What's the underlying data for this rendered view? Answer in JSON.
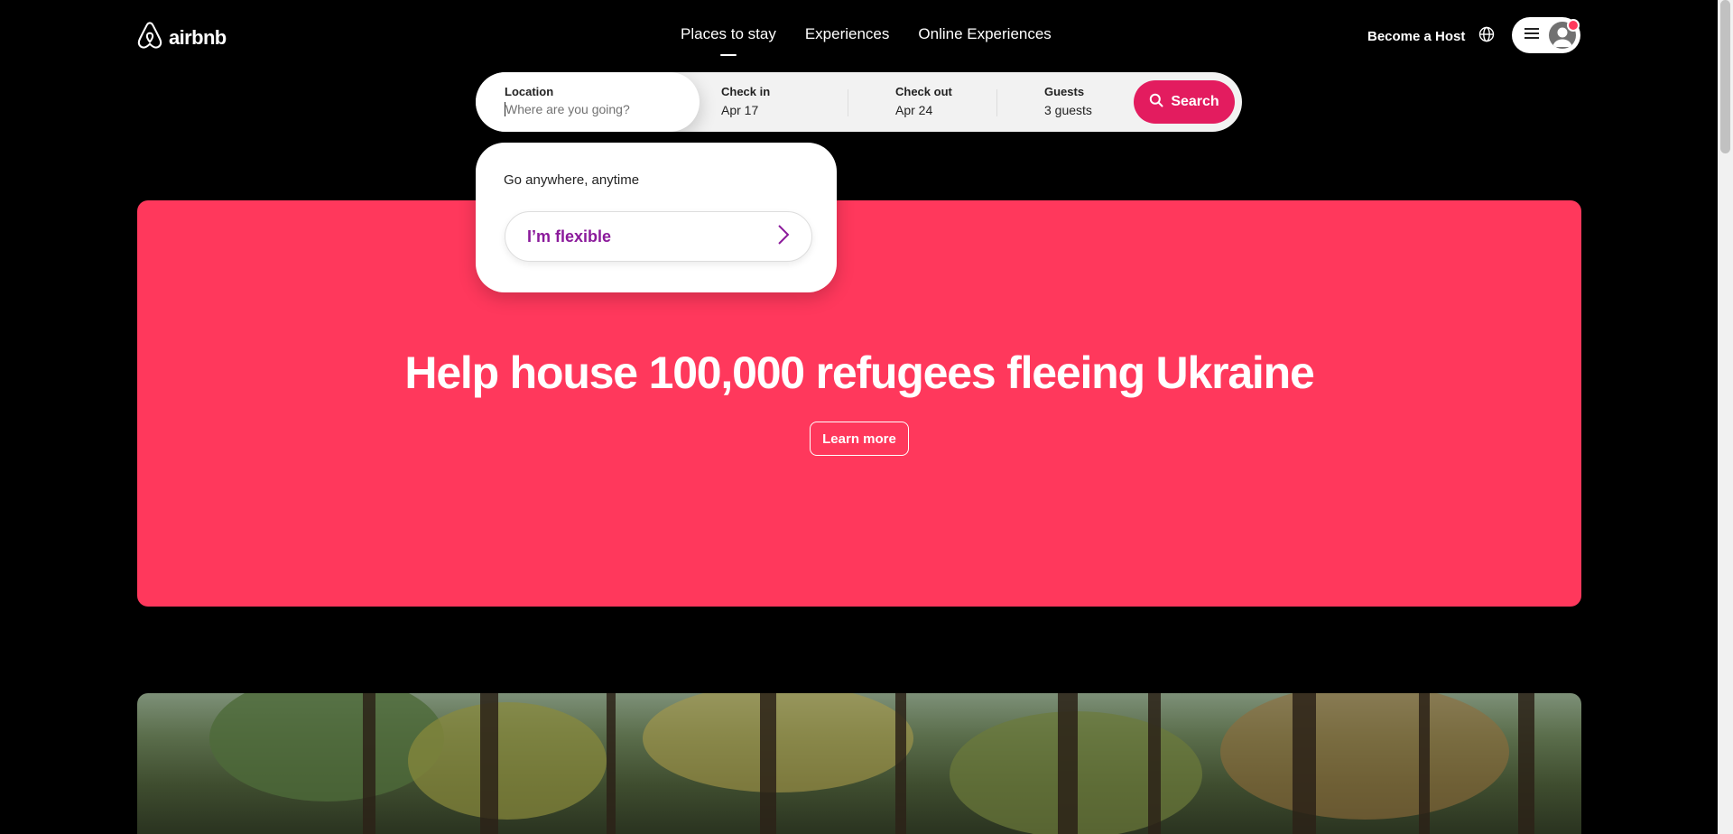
{
  "brand": {
    "name": "airbnb",
    "accent_color": "#FF385C"
  },
  "nav": {
    "tabs": [
      {
        "label": "Places to stay",
        "active": true
      },
      {
        "label": "Experiences",
        "active": false
      },
      {
        "label": "Online Experiences",
        "active": false
      }
    ],
    "host_link": "Become a Host",
    "globe_icon": "globe-icon",
    "menu_icon": "hamburger-menu-icon",
    "avatar_icon": "user-avatar-icon"
  },
  "search": {
    "location": {
      "label": "Location",
      "value": "",
      "placeholder": "Where are you going?"
    },
    "check_in": {
      "label": "Check in",
      "value": "Apr 17"
    },
    "check_out": {
      "label": "Check out",
      "value": "Apr 24"
    },
    "guests": {
      "label": "Guests",
      "value": "3 guests"
    },
    "button_label": "Search",
    "button_color": "#E31C5F"
  },
  "flexible_panel": {
    "heading": "Go anywhere, anytime",
    "button_label": "I’m flexible",
    "button_icon": "chevron-right-icon"
  },
  "banner": {
    "title": "Help house 100,000 refugees fleeing Ukraine",
    "button_label": "Learn more",
    "background_color": "#FF385C"
  },
  "hero_image": {
    "subject": "forest-image"
  }
}
